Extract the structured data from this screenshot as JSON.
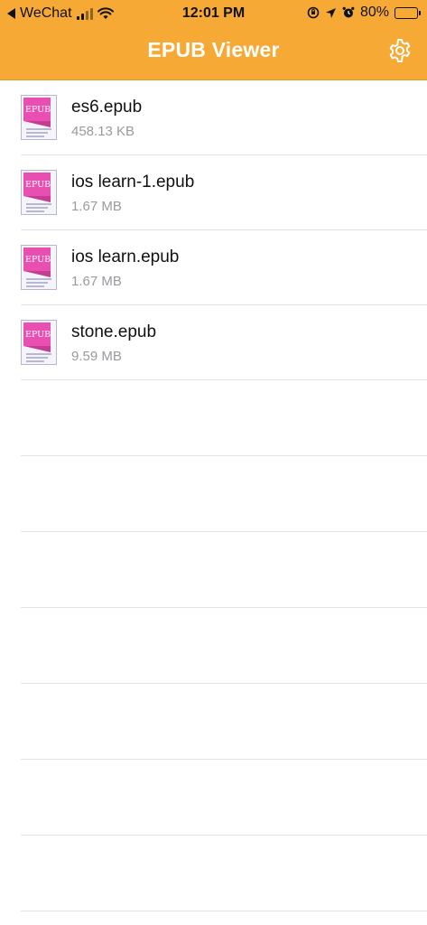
{
  "status_bar": {
    "back_app": "WeChat",
    "time": "12:01 PM",
    "battery": "80%",
    "battery_level": 0.8
  },
  "header": {
    "title": "EPUB Viewer"
  },
  "icons": {
    "settings": "gear-icon",
    "file": "epub-file-icon"
  },
  "colors": {
    "header_bg": "#f6aa35",
    "icon_pink": "#e94fb0"
  },
  "files": [
    {
      "name": "es6.epub",
      "size": "458.13 KB"
    },
    {
      "name": "ios learn-1.epub",
      "size": "1.67 MB"
    },
    {
      "name": "ios learn.epub",
      "size": "1.67 MB"
    },
    {
      "name": "stone.epub",
      "size": "9.59 MB"
    }
  ],
  "epub_icon_text": "EPUB"
}
